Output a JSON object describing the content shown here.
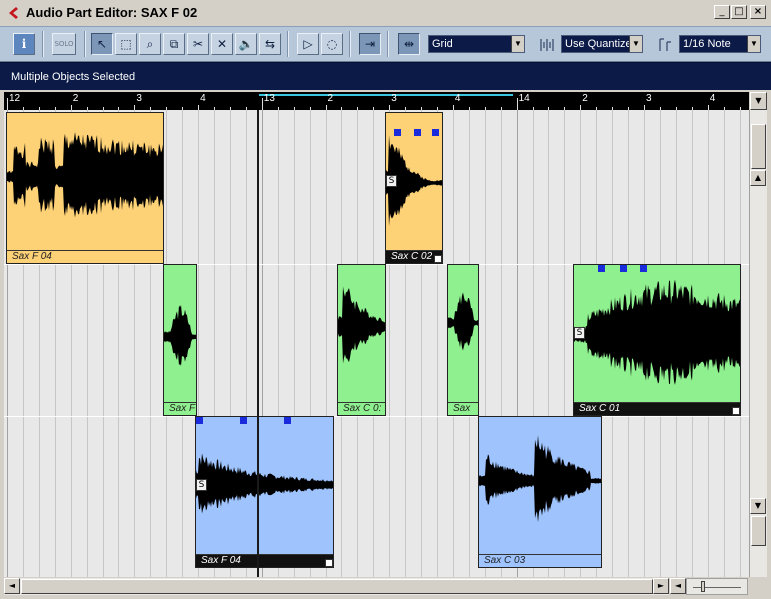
{
  "window": {
    "title": "Audio Part Editor: SAX F 02",
    "min_glyph": "_",
    "max_glyph": "□",
    "close_glyph": "×"
  },
  "toolbar": {
    "info_label": "i",
    "solo_label": "SOLO",
    "tools": [
      {
        "name": "object-selection",
        "glyph": "↖"
      },
      {
        "name": "range-selection",
        "glyph": "⬚"
      },
      {
        "name": "zoom",
        "glyph": "⌕"
      },
      {
        "name": "glue",
        "glyph": "⧉"
      },
      {
        "name": "split",
        "glyph": "✂"
      },
      {
        "name": "erase",
        "glyph": "✕"
      },
      {
        "name": "mute",
        "glyph": "🔈"
      },
      {
        "name": "time-warp",
        "glyph": "⇆"
      },
      {
        "name": "play",
        "glyph": "▷"
      },
      {
        "name": "scrub",
        "glyph": "◌"
      },
      {
        "name": "autoscroll",
        "glyph": "⇥"
      },
      {
        "name": "snap",
        "glyph": "⇹"
      }
    ],
    "snap_mode": "Grid",
    "quantize_mode": "Use Quantize",
    "quantize_value": "1/16 Note",
    "dropdown_arrow": "▼"
  },
  "info_line": {
    "text": "Multiple Objects Selected"
  },
  "ruler": {
    "labels": [
      "12",
      "2",
      "3",
      "4",
      "13",
      "2",
      "3",
      "4",
      "14",
      "2",
      "3",
      "4"
    ],
    "arrow": "▼"
  },
  "events": [
    {
      "name": "Sax F 04",
      "color": "orange",
      "selected": false,
      "s_mark": false
    },
    {
      "name": "Sax C 02",
      "color": "orange",
      "selected": true,
      "s_mark": true
    },
    {
      "name": "Sax F",
      "color": "green",
      "selected": false,
      "s_mark": false
    },
    {
      "name": "Sax C 0:",
      "color": "green",
      "selected": false,
      "s_mark": false
    },
    {
      "name": "Sax C",
      "color": "green",
      "selected": false,
      "s_mark": false
    },
    {
      "name": "Sax C 01",
      "color": "green",
      "selected": true,
      "s_mark": true
    },
    {
      "name": "Sax F 04",
      "color": "blue",
      "selected": true,
      "s_mark": true
    },
    {
      "name": "Sax C 03",
      "color": "blue",
      "selected": false,
      "s_mark": false
    }
  ],
  "s_mark_label": "S",
  "scroll": {
    "up": "▲",
    "down": "▼",
    "left": "◄",
    "right": "►"
  },
  "colors": {
    "orange": "#fdd176",
    "green": "#8ff08f",
    "blue": "#9fc3fd",
    "handle": "#1a2bdc",
    "toolbar": "#b7c7da",
    "info_line": "#0b1a46"
  }
}
